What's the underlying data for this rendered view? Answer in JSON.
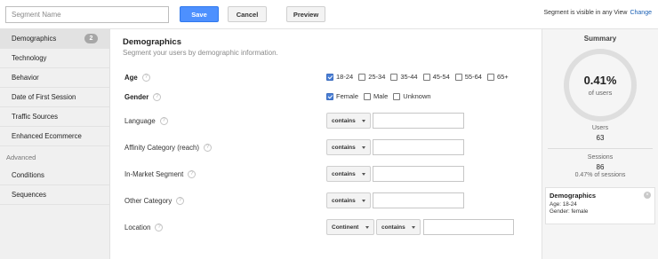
{
  "topbar": {
    "segment_name_placeholder": "Segment Name",
    "save_label": "Save",
    "cancel_label": "Cancel",
    "preview_label": "Preview",
    "visibility_text": "Segment is visible in any View",
    "change_label": "Change"
  },
  "sidebar": {
    "items": [
      {
        "label": "Demographics",
        "badge": "2",
        "active": true
      },
      {
        "label": "Technology"
      },
      {
        "label": "Behavior"
      },
      {
        "label": "Date of First Session"
      },
      {
        "label": "Traffic Sources"
      },
      {
        "label": "Enhanced Ecommerce"
      }
    ],
    "advanced_heading": "Advanced",
    "advanced_items": [
      {
        "label": "Conditions"
      },
      {
        "label": "Sequences"
      }
    ]
  },
  "main": {
    "title": "Demographics",
    "subtitle": "Segment your users by demographic information.",
    "help_glyph": "?",
    "age": {
      "label": "Age",
      "options": [
        {
          "label": "18-24",
          "checked": true
        },
        {
          "label": "25-34",
          "checked": false
        },
        {
          "label": "35-44",
          "checked": false
        },
        {
          "label": "45-54",
          "checked": false
        },
        {
          "label": "55-64",
          "checked": false
        },
        {
          "label": "65+",
          "checked": false
        }
      ]
    },
    "gender": {
      "label": "Gender",
      "options": [
        {
          "label": "Female",
          "checked": true
        },
        {
          "label": "Male",
          "checked": false
        },
        {
          "label": "Unknown",
          "checked": false
        }
      ]
    },
    "language": {
      "label": "Language",
      "operator": "contains",
      "value": ""
    },
    "affinity": {
      "label": "Affinity Category (reach)",
      "operator": "contains",
      "value": ""
    },
    "in_market": {
      "label": "In-Market Segment",
      "operator": "contains",
      "value": ""
    },
    "other": {
      "label": "Other Category",
      "operator": "contains",
      "value": ""
    },
    "location": {
      "label": "Location",
      "scope": "Continent",
      "operator": "contains",
      "value": ""
    }
  },
  "summary": {
    "title": "Summary",
    "percent": "0.41%",
    "percent_label": "of users",
    "users_label": "Users",
    "users_value": "63",
    "sessions_label": "Sessions",
    "sessions_value": "86",
    "sessions_pct": "0.47% of sessions",
    "card": {
      "title": "Demographics",
      "line1": "Age: 18-24",
      "line2": "Gender: female",
      "close_glyph": "×"
    }
  },
  "colors": {
    "accent": "#4d90fe",
    "link": "#1a5fb4",
    "checkbox": "#4a7fd6"
  }
}
